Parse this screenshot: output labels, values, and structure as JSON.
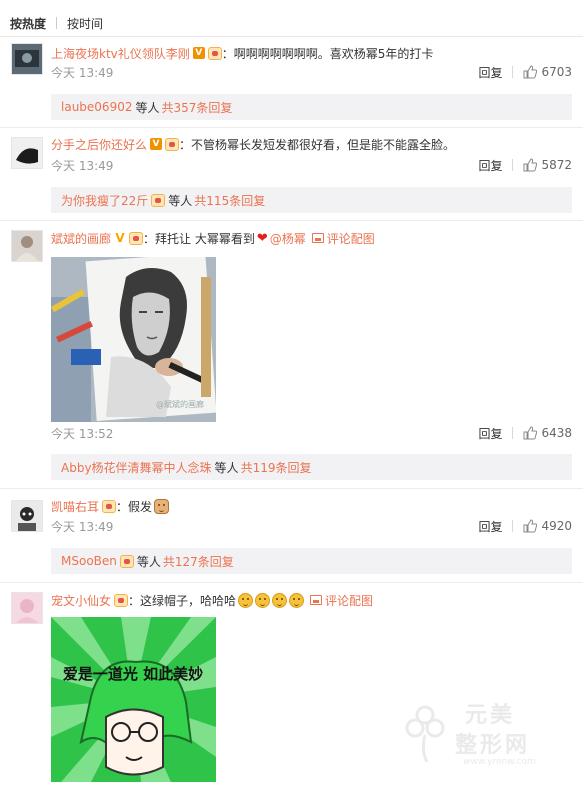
{
  "sort": {
    "hot": "按热度",
    "time": "按时间"
  },
  "actions": {
    "reply": "回复",
    "pic_comment": "评论配图"
  },
  "comments": [
    {
      "user": "上海夜场ktv礼仪领队李刚",
      "text": "：啊啊啊啊啊啊啊。喜欢杨幂5年的打卡",
      "time": "今天 13:49",
      "likes": "6703",
      "sub_user": "laube06902",
      "sub_suffix": "等人",
      "sub_count": "共357条回复"
    },
    {
      "user": "分手之后你还好么",
      "text": "：不管杨幂长发短发都很好看，但是能不能露全脸。",
      "time": "今天 13:49",
      "likes": "5872",
      "sub_user": "为你我瘦了22斤",
      "sub_suffix": "等人",
      "sub_count": "共115条回复"
    },
    {
      "user": "斌斌的画廊",
      "text": "：拜托让 大幂幂看到",
      "mention": "@杨幂",
      "time": "今天 13:52",
      "likes": "6438",
      "sub_user": "Abby杨花伴清舞幂中人念珠",
      "sub_suffix": "等人",
      "sub_count": "共119条回复",
      "image_watermark": "@斌斌的画廊"
    },
    {
      "user": "凯喵右耳",
      "text": "：假发",
      "time": "今天 13:49",
      "likes": "4920",
      "sub_user": "MSooBen",
      "sub_suffix": "等人",
      "sub_count": "共127条回复"
    },
    {
      "user": "宠文小仙女",
      "text": "：这绿帽子，哈哈哈",
      "image_caption": "爱是一道光 如此美妙"
    }
  ],
  "watermark": {
    "line1": "元美",
    "line2": "整形网",
    "url": "www.yrenw.com"
  },
  "colors": {
    "link": "#eb7350",
    "subbox_bg": "#f2f2f5",
    "time": "#999999"
  }
}
